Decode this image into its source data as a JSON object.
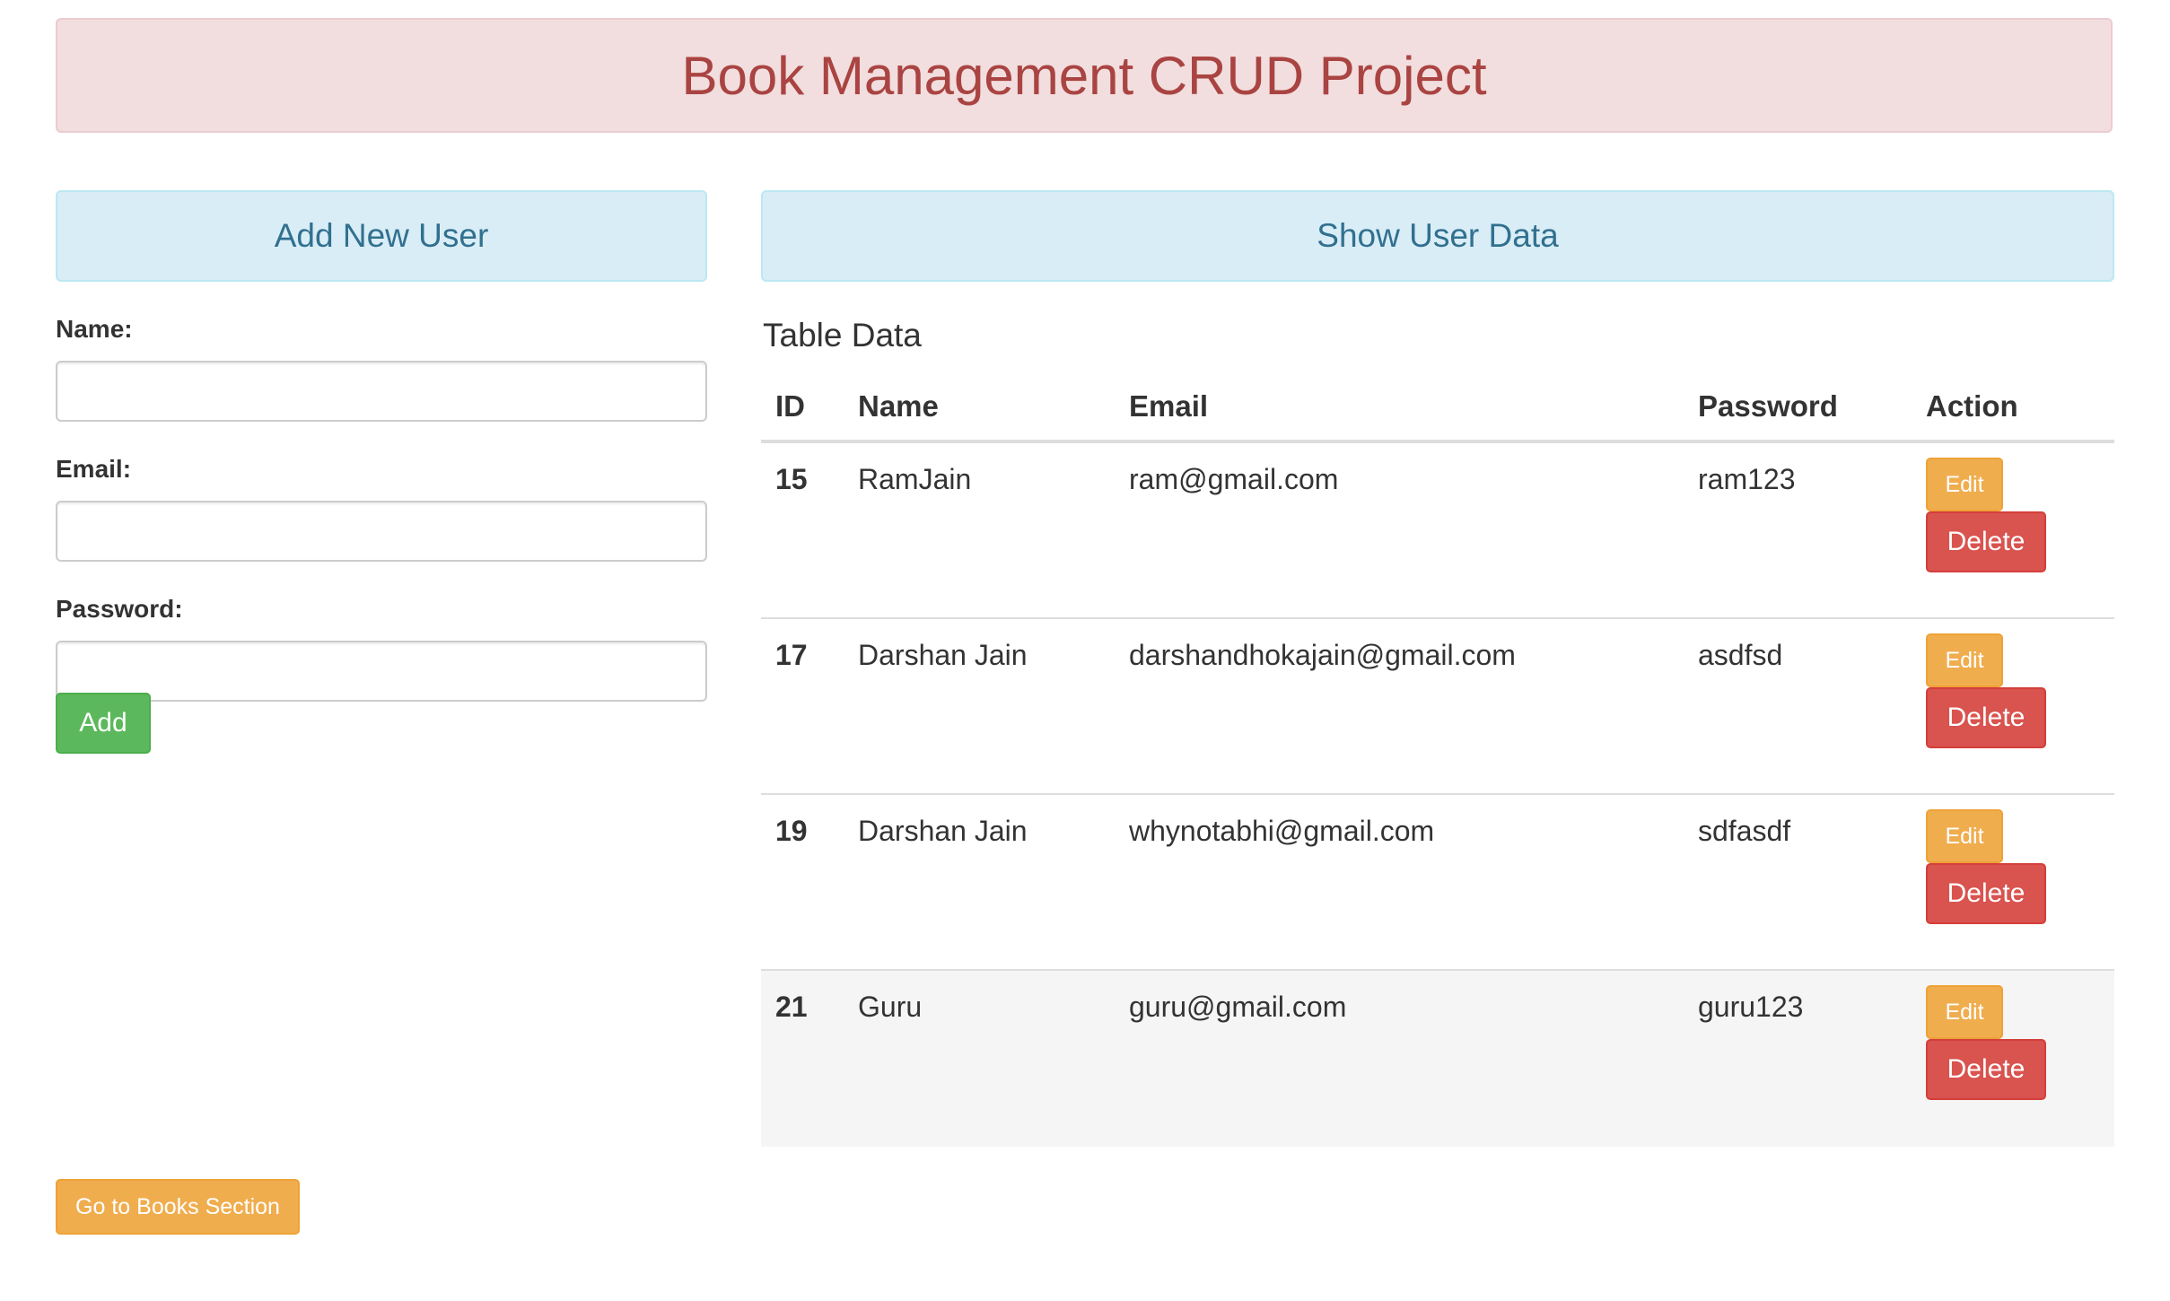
{
  "header": {
    "title": "Book Management CRUD Project"
  },
  "add_panel": {
    "title": "Add New User",
    "fields": [
      {
        "label": "Name:",
        "value": "",
        "placeholder": ""
      },
      {
        "label": "Email:",
        "value": "",
        "placeholder": ""
      },
      {
        "label": "Password:",
        "value": "",
        "placeholder": ""
      }
    ],
    "add_button": "Add"
  },
  "show_panel": {
    "title": "Show User Data",
    "table_title": "Table Data",
    "columns": [
      "ID",
      "Name",
      "Email",
      "Password",
      "Action"
    ],
    "rows": [
      {
        "id": "15",
        "name": "RamJain",
        "email": "ram@gmail.com",
        "password": "ram123",
        "edit": "Edit",
        "delete": "Delete"
      },
      {
        "id": "17",
        "name": "Darshan Jain",
        "email": "darshandhokajain@gmail.com",
        "password": "asdfsd",
        "edit": "Edit",
        "delete": "Delete"
      },
      {
        "id": "19",
        "name": "Darshan Jain",
        "email": "whynotabhi@gmail.com",
        "password": "sdfasdf",
        "edit": "Edit",
        "delete": "Delete"
      },
      {
        "id": "21",
        "name": "Guru",
        "email": "guru@gmail.com",
        "password": "guru123",
        "edit": "Edit",
        "delete": "Delete"
      }
    ]
  },
  "footer": {
    "books_button": "Go to Books Section"
  },
  "colors": {
    "danger_banner_bg": "#f2dede",
    "danger_text": "#a94442",
    "info_bg": "#d9edf7",
    "info_text": "#31708f",
    "success": "#5cb85c",
    "warning": "#f0ad4e",
    "danger": "#d9534f"
  }
}
